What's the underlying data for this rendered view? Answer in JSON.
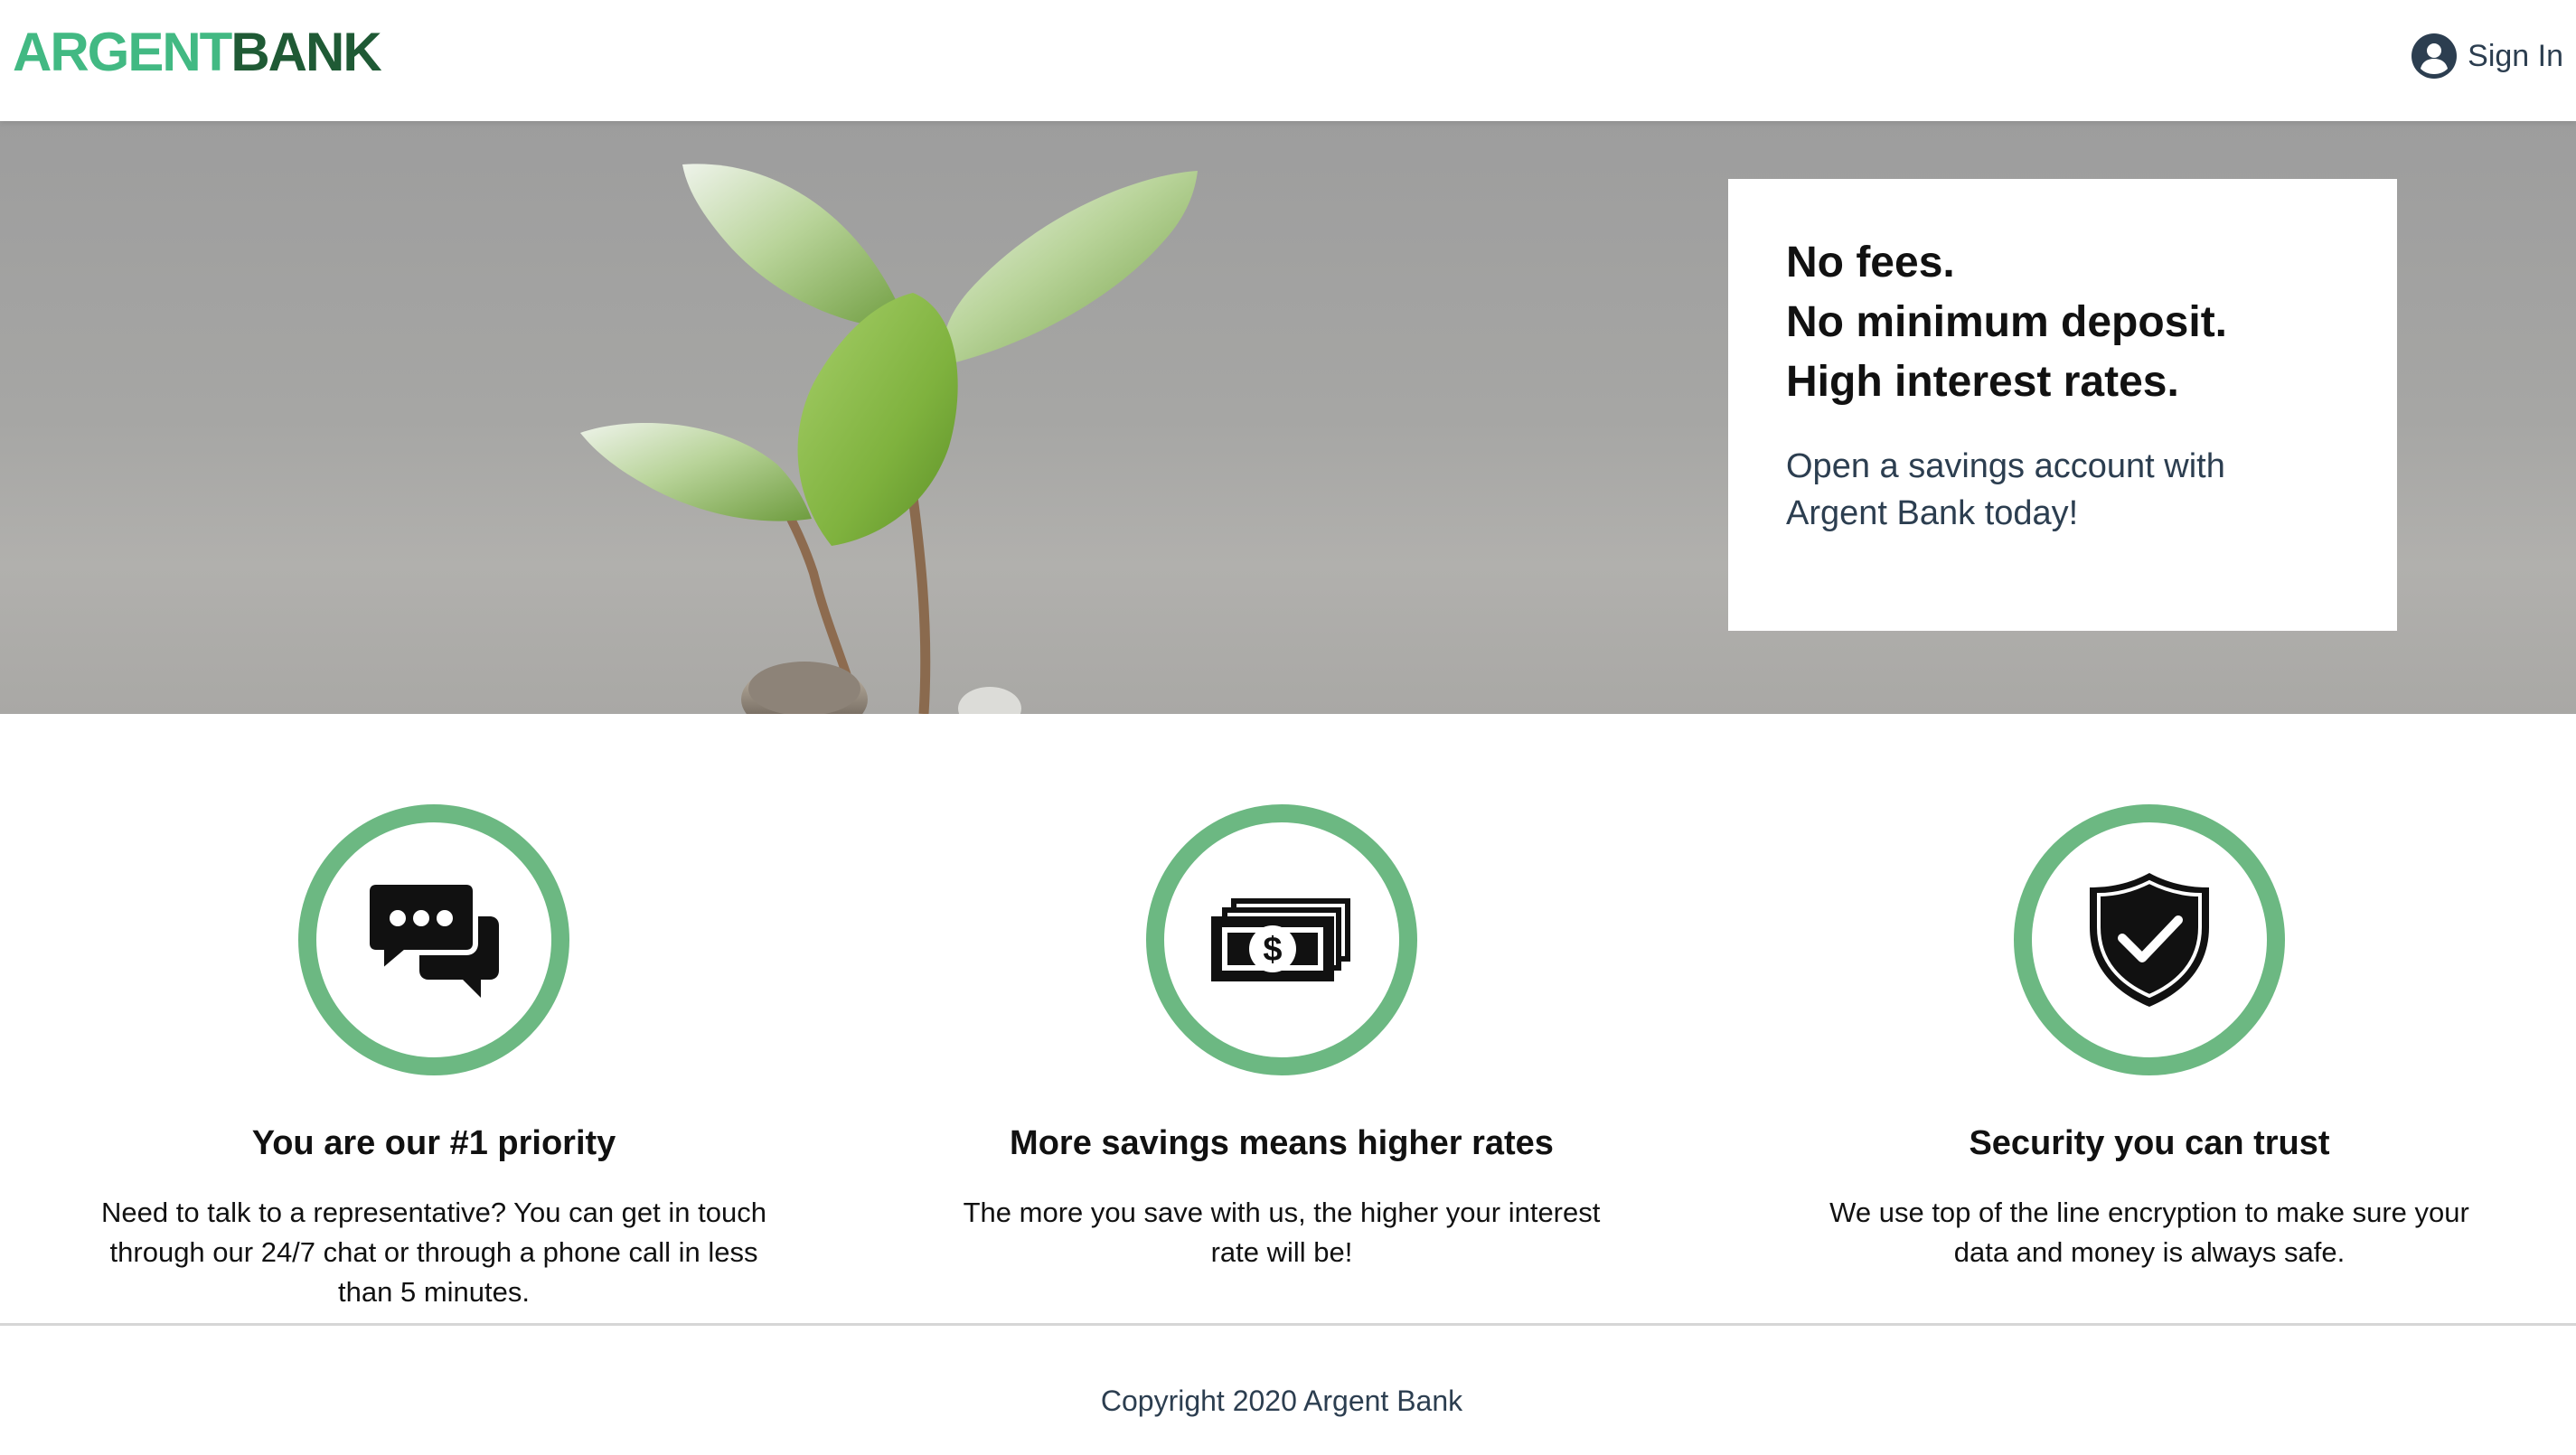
{
  "brand": {
    "name_part1": "ARGENT",
    "name_part2": "BANK",
    "primary_color": "#42b983",
    "dark_color": "#1f5a35"
  },
  "header": {
    "signin_label": "Sign In",
    "signin_icon": "user-circle-icon"
  },
  "hero": {
    "headline_lines": [
      "No fees.",
      "No minimum deposit.",
      "High interest rates."
    ],
    "subtitle": "Open a savings account with Argent Bank today!",
    "image": "plant-sprout-growing-from-coins"
  },
  "features": [
    {
      "icon": "chat-icon",
      "title": "You are our #1 priority",
      "text": "Need to talk to a representative? You can get in touch through our 24/7 chat or through a phone call in less than 5 minutes."
    },
    {
      "icon": "money-icon",
      "title": "More savings means higher rates",
      "text": "The more you save with us, the higher your interest rate will be!"
    },
    {
      "icon": "security-shield-icon",
      "title": "Security you can trust",
      "text": "We use top of the line encryption to make sure your data and money is always safe."
    }
  ],
  "footer": {
    "copyright": "Copyright 2020 Argent Bank"
  },
  "colors": {
    "feature_ring": "#6cb882",
    "text": "#2c3e50"
  }
}
